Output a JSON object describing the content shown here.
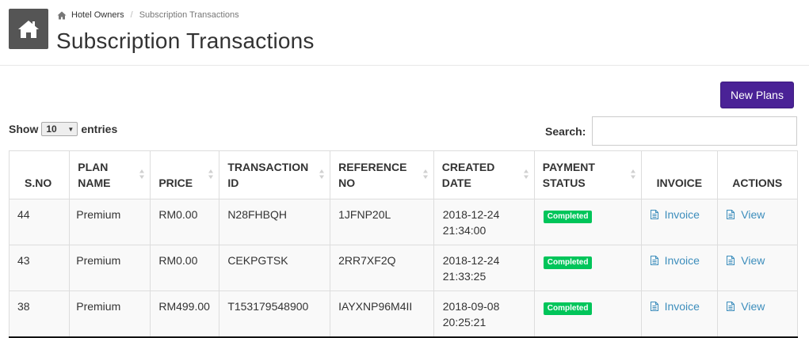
{
  "breadcrumb": {
    "items": [
      "Hotel Owners",
      "Subscription Transactions"
    ]
  },
  "page": {
    "title": "Subscription Transactions",
    "new_plans_label": "New Plans"
  },
  "table_controls": {
    "show_label": "Show",
    "entries_value": "10",
    "entries_label": "entries",
    "search_label": "Search:",
    "search_value": ""
  },
  "table": {
    "headers": [
      {
        "line1": "S.NO",
        "line2": ""
      },
      {
        "line1": "PLAN",
        "line2": "NAME"
      },
      {
        "line1": "PRICE",
        "line2": ""
      },
      {
        "line1": "TRANSACTION",
        "line2": "ID"
      },
      {
        "line1": "REFERENCE",
        "line2": "NO"
      },
      {
        "line1": "CREATED",
        "line2": "DATE"
      },
      {
        "line1": "PAYMENT",
        "line2": "STATUS"
      },
      {
        "line1": "INVOICE",
        "line2": ""
      },
      {
        "line1": "ACTIONS",
        "line2": ""
      }
    ],
    "rows": [
      {
        "sno": "44",
        "plan": "Premium",
        "price": "RM0.00",
        "transaction_id": "N28FHBQH",
        "reference_no": "1JFNP20L",
        "date": "2018-12-24",
        "time": "21:34:00",
        "status": "Completed",
        "invoice": "Invoice",
        "action": "View"
      },
      {
        "sno": "43",
        "plan": "Premium",
        "price": "RM0.00",
        "transaction_id": "CEKPGTSK",
        "reference_no": "2RR7XF2Q",
        "date": "2018-12-24",
        "time": "21:33:25",
        "status": "Completed",
        "invoice": "Invoice",
        "action": "View"
      },
      {
        "sno": "38",
        "plan": "Premium",
        "price": "RM499.00",
        "transaction_id": "T153179548900",
        "reference_no": "IAYXNP96M4II",
        "date": "2018-09-08",
        "time": "20:25:21",
        "status": "Completed",
        "invoice": "Invoice",
        "action": "View"
      }
    ]
  },
  "icons": {
    "home_tile": "home-icon",
    "breadcrumb_home": "home-icon",
    "invoice": "file-text-icon",
    "view": "file-text-icon",
    "sort": "sort-icon"
  },
  "colors": {
    "home_tile_bg": "#555555",
    "primary_button": "#4a2296",
    "status_completed": "#00c55a",
    "link": "#3c8dbc"
  }
}
